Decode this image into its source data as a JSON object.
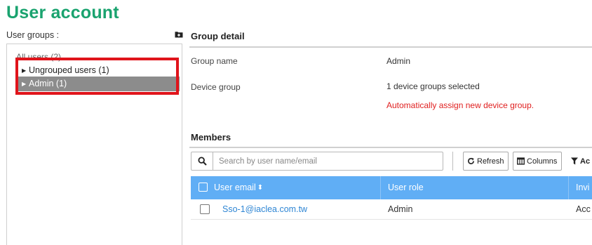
{
  "page": {
    "title": "User account"
  },
  "groups": {
    "header": "User groups :",
    "add_icon": "folder-plus-icon",
    "root_label": "All users (2)",
    "items": [
      {
        "label": "Ungrouped users (1)",
        "selected": false
      },
      {
        "label": "Admin (1)",
        "selected": true
      }
    ]
  },
  "detail": {
    "header": "Group detail",
    "group_name_label": "Group name",
    "group_name_value": "Admin",
    "device_group_label": "Device group",
    "device_group_value": "1 device groups selected",
    "auto_assign_text": "Automatically assign new device group."
  },
  "members": {
    "header": "Members",
    "search_icon": "search-icon",
    "search_placeholder": "Search by user name/email",
    "refresh_label": "Refresh",
    "columns_label": "Columns",
    "filter_label": "Ac",
    "columns": [
      "User email",
      "User role",
      "Invi"
    ],
    "rows": [
      {
        "email": "Sso-1@iaclea.com.tw",
        "role": "Admin",
        "status": "Acc"
      }
    ]
  },
  "colors": {
    "title": "#1aa36f",
    "table_header": "#60aef5",
    "selected_group": "#8c8c8c",
    "highlight": "#e0141b",
    "alert_text": "#e02020",
    "link": "#2f86d4"
  }
}
